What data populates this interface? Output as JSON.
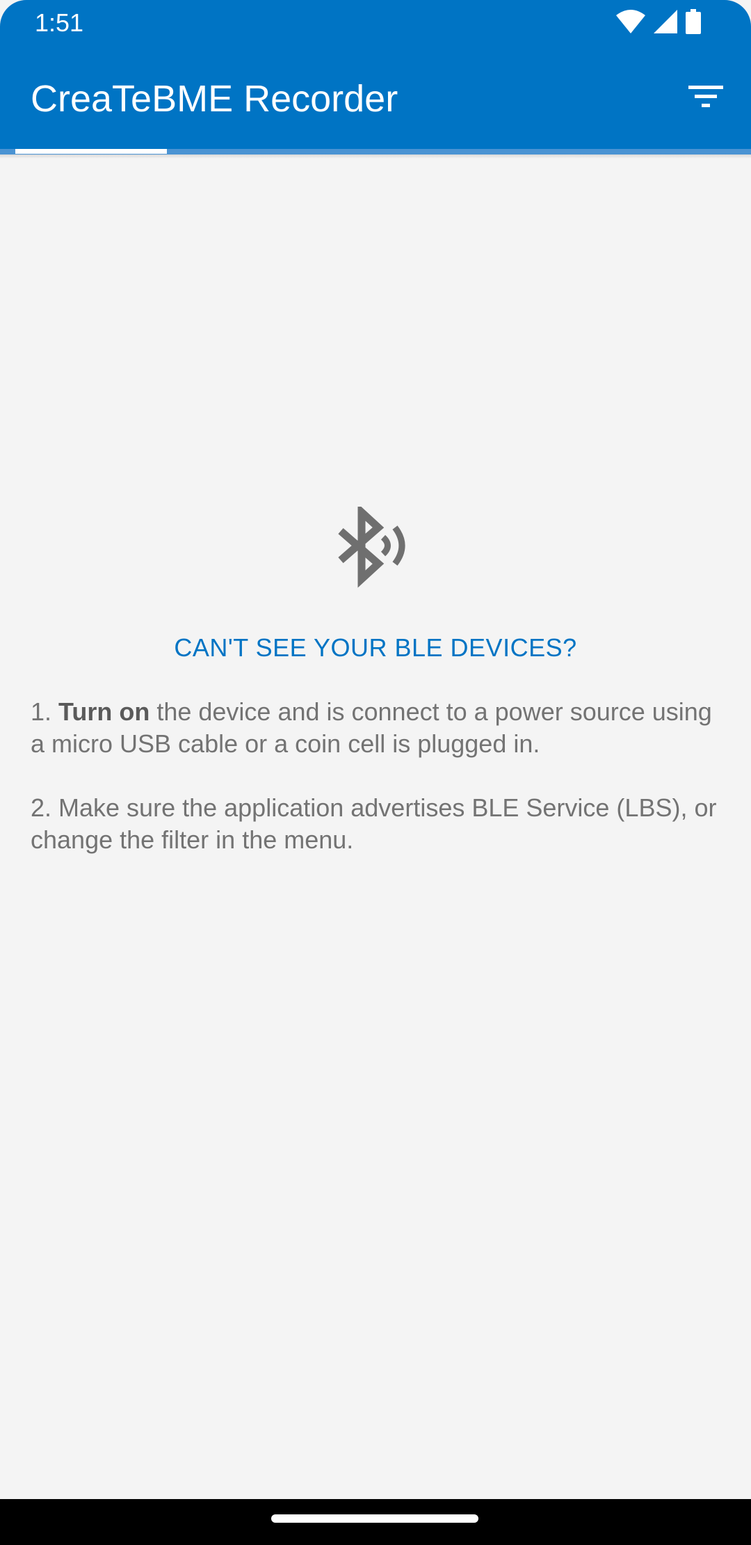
{
  "status_bar": {
    "time": "1:51",
    "icons": [
      "wifi-icon",
      "cell-signal-icon",
      "battery-icon"
    ]
  },
  "app_bar": {
    "title": "CreaTeBME Recorder",
    "filter_icon": "filter-icon"
  },
  "colors": {
    "primary": "#0074c4",
    "background": "#f4f4f4",
    "text_secondary": "#737373",
    "icon_gray": "#6f6f6f"
  },
  "empty_state": {
    "icon": "bluetooth-searching-icon",
    "headline": "CAN'T SEE YOUR BLE DEVICES?",
    "step1_prefix": "1. ",
    "step1_bold": "Turn on",
    "step1_rest": " the device and is connect to a power source using a micro USB cable or a coin cell is plugged in.",
    "step2": "2. Make sure the application advertises BLE Service (LBS), or change the filter in the menu."
  }
}
